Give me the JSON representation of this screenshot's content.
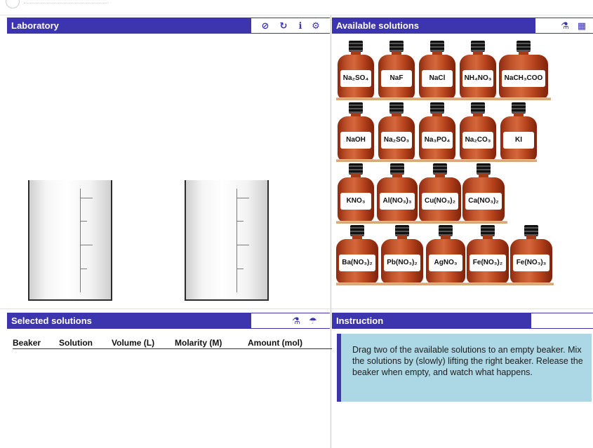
{
  "laboratory": {
    "title": "Laboratory",
    "tools": [
      "⊘",
      "↻",
      "ℹ",
      "⚙"
    ]
  },
  "available": {
    "title": "Available solutions",
    "tools": [
      "⚗",
      "▦"
    ],
    "rows": [
      [
        "Na₂SO₄",
        "NaF",
        "NaCl",
        "NH₄NO₃",
        "NaCH₃COO"
      ],
      [
        "NaOH",
        "Na₂SO₃",
        "Na₃PO₄",
        "Na₂CO₃",
        "KI"
      ],
      [
        "KNO₃",
        "Al(NO₃)₃",
        "Cu(NO₃)₂",
        "Ca(NO₃)₂"
      ],
      [
        "Ba(NO₃)₂",
        "Pb(NO₃)₂",
        "AgNO₃",
        "Fe(NO₃)₂",
        "Fe(NO₃)₃"
      ]
    ]
  },
  "selected": {
    "title": "Selected solutions",
    "tools": [
      "⚗",
      "☂"
    ],
    "columns": [
      "Beaker",
      "Solution",
      "Volume (L)",
      "Molarity (M)",
      "Amount (mol)"
    ]
  },
  "instruction": {
    "title": "Instruction",
    "text": "Drag two of the available solutions to an empty beaker. Mix the solutions by (slowly) lifting the right beaker. Release the beaker when empty, and watch what happens."
  },
  "colors": {
    "header": "#3d35ad",
    "bottle": "#c0532b",
    "shelf": "#d7a978",
    "instruction_bg": "#acd8e6"
  }
}
